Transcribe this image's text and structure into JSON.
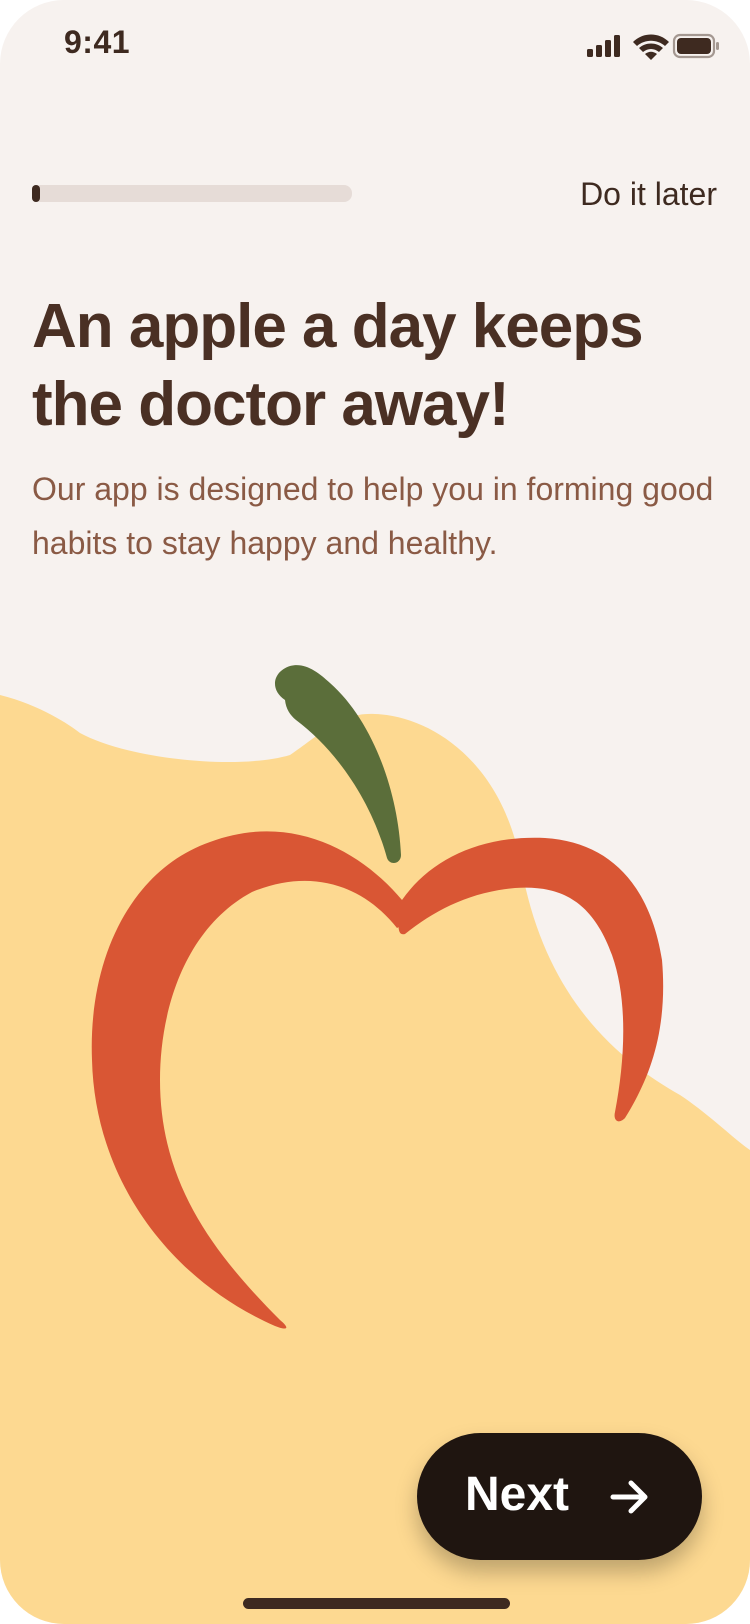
{
  "status_bar": {
    "time": "9:41",
    "icons": [
      "cellular-signal-icon",
      "wifi-icon",
      "battery-icon"
    ]
  },
  "onboarding": {
    "progress_fraction": 0.02,
    "skip_label": "Do it later",
    "headline": "An apple a day keeps the doctor away!",
    "subtitle": "Our app is designed to help you in forming good habits to stay happy and healthy.",
    "illustration": "apple-illustration",
    "next_label": "Next",
    "next_icon": "arrow-right-icon"
  },
  "colors": {
    "background": "#f7f2ef",
    "blob": "#fdd991",
    "apple": "#d95634",
    "stem": "#5b6e3a",
    "text_dark": "#4a3024",
    "text_muted": "#8a5a45",
    "button": "#1f1510"
  }
}
